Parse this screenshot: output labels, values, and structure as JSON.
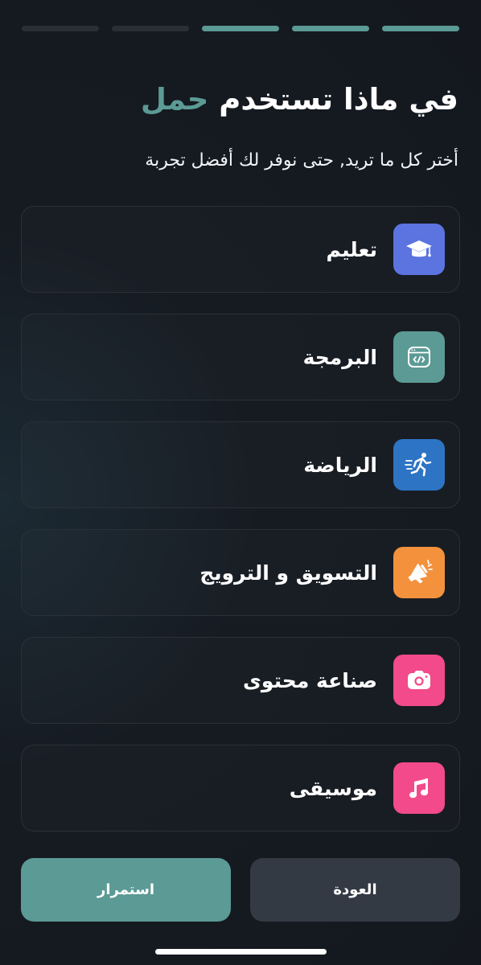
{
  "progress": {
    "total_steps": 5,
    "completed_steps": 3
  },
  "header": {
    "title_prefix": "في ماذا تستخدم ",
    "title_accent": "حمل",
    "subtitle": "أختر كل ما تريد, حتى نوفر لك أفضل تجربة"
  },
  "options": [
    {
      "label": "تعليم",
      "icon": "graduation-cap-icon",
      "color": "#5b74e0"
    },
    {
      "label": "البرمجة",
      "icon": "code-window-icon",
      "color": "#5c9a95"
    },
    {
      "label": "الرياضة",
      "icon": "running-person-icon",
      "color": "#2d74c4"
    },
    {
      "label": "التسويق و الترويج",
      "icon": "megaphone-icon",
      "color": "#f3913c"
    },
    {
      "label": "صناعة محتوى",
      "icon": "camera-icon",
      "color": "#f24a8a"
    },
    {
      "label": "موسيقى",
      "icon": "music-note-icon",
      "color": "#f24a8a"
    }
  ],
  "buttons": {
    "back": "العودة",
    "continue": "استمرار"
  },
  "colors": {
    "accent": "#5c9a95",
    "background": "#15191f",
    "progress_inactive": "#2a2f37"
  }
}
